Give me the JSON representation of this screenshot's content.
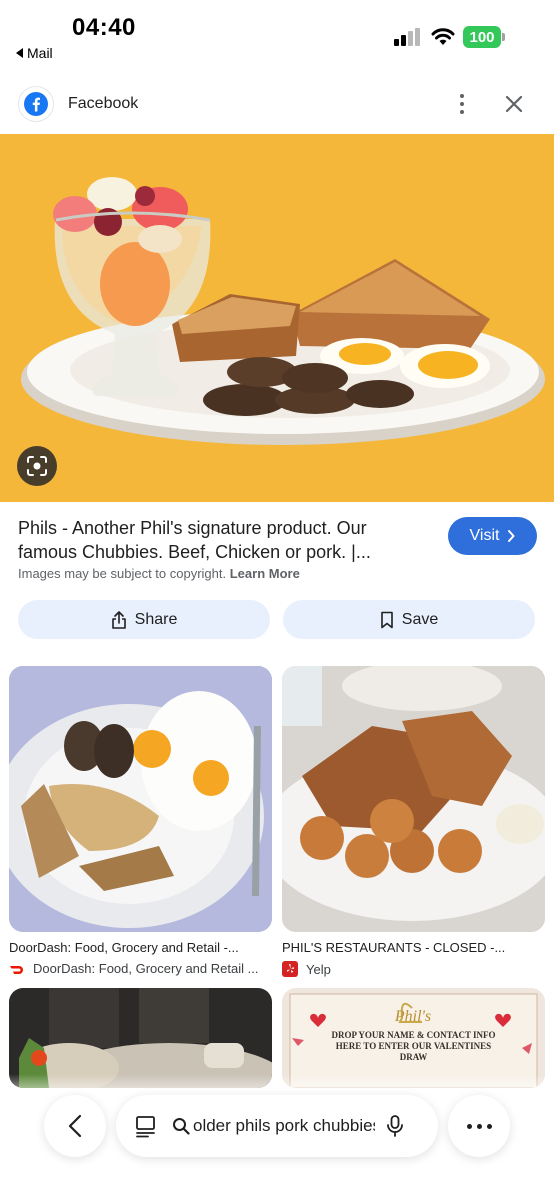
{
  "status_bar": {
    "time": "04:40",
    "back_app": "Mail",
    "battery": "100"
  },
  "source": {
    "name": "Facebook"
  },
  "result": {
    "title": "Phils - Another Phil's signature product. Our famous Chubbies. Beef, Chicken or pork. |...",
    "visit_label": "Visit",
    "copyright_text": "Images may be subject to copyright.",
    "learn_more": "Learn More",
    "share_label": "Share",
    "save_label": "Save"
  },
  "related": [
    {
      "caption": "DoorDash: Food, Grocery and Retail -...",
      "source": "DoorDash: Food, Grocery and Retail ..."
    },
    {
      "caption": "PHIL'S RESTAURANTS - CLOSED -...",
      "source": "Yelp"
    },
    {
      "image_text": "DROP YOUR NAME & CONTACT INFO HERE TO ENTER OUR VALENTINES DRAW"
    }
  ],
  "bottom_bar": {
    "query": "older phils pork chubbies"
  },
  "colors": {
    "hero_bg": "#f4b73a",
    "visit_button": "#2f6fdb",
    "action_button": "#e8f0fe",
    "battery": "#34c759"
  }
}
